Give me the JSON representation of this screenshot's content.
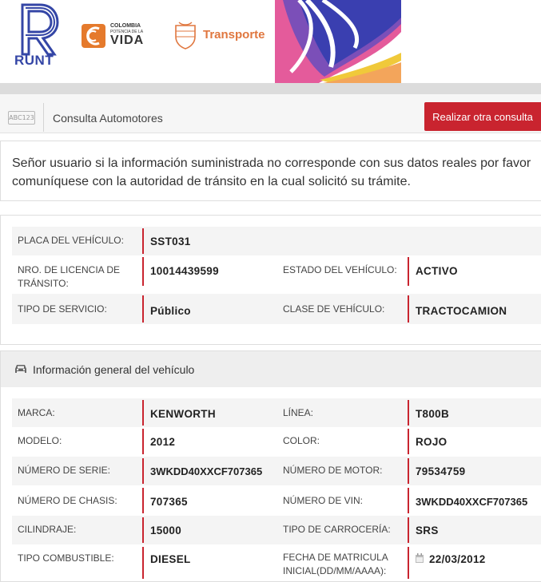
{
  "header": {
    "runt_logo_text": "RUNT",
    "colombia_logo": {
      "line1": "COLOMBIA",
      "line2": "POTENCIA DE LA",
      "line3": "VIDA"
    },
    "transporte_label": "Transporte"
  },
  "consulta": {
    "badge": "ABC123",
    "title": "Consulta Automotores",
    "button_label": "Realizar otra consulta"
  },
  "notice": "Señor usuario si la información suministrada no corresponde con sus datos reales por favor comuníquese con la autoridad de tránsito en la cual solicitó su trámite.",
  "summary": {
    "placa_label": "PLACA DEL VEHÍCULO:",
    "placa_value": "SST031",
    "licencia_label": "NRO. DE LICENCIA DE TRÁNSITO:",
    "licencia_value": "10014439599",
    "estado_label": "ESTADO DEL VEHÍCULO:",
    "estado_value": "ACTIVO",
    "servicio_label": "TIPO DE SERVICIO:",
    "servicio_value": "Público",
    "clase_label": "CLASE DE VEHÍCULO:",
    "clase_value": "TRACTOCAMION"
  },
  "general": {
    "title": "Información general del vehículo",
    "marca_label": "MARCA:",
    "marca_value": "KENWORTH",
    "linea_label": "LÍNEA:",
    "linea_value": "T800B",
    "modelo_label": "MODELO:",
    "modelo_value": "2012",
    "color_label": "COLOR:",
    "color_value": "ROJO",
    "serie_label": "NÚMERO DE SERIE:",
    "serie_value": "3WKDD40XXCF707365",
    "motor_label": "NÚMERO DE MOTOR:",
    "motor_value": "79534759",
    "chasis_label": "NÚMERO DE CHASIS:",
    "chasis_value": "707365",
    "vin_label": "NÚMERO DE VIN:",
    "vin_value": "3WKDD40XXCF707365",
    "cilindraje_label": "CILINDRAJE:",
    "cilindraje_value": "15000",
    "carroceria_label": "TIPO DE CARROCERÍA:",
    "carroceria_value": "SRS",
    "combustible_label": "TIPO COMBUSTIBLE:",
    "combustible_value": "DIESEL",
    "matricula_label": "FECHA DE MATRICULA INICIAL(DD/MM/AAAA):",
    "matricula_value": "22/03/2012"
  },
  "colors": {
    "accent_red": "#c9242f",
    "runt_blue": "#3446a6",
    "transporte_orange": "#e0773f"
  },
  "icons": [
    "runt-logo",
    "colombia-logo",
    "coat-of-arms-icon",
    "abc123-plate-icon",
    "car-icon",
    "calendar-icon"
  ]
}
